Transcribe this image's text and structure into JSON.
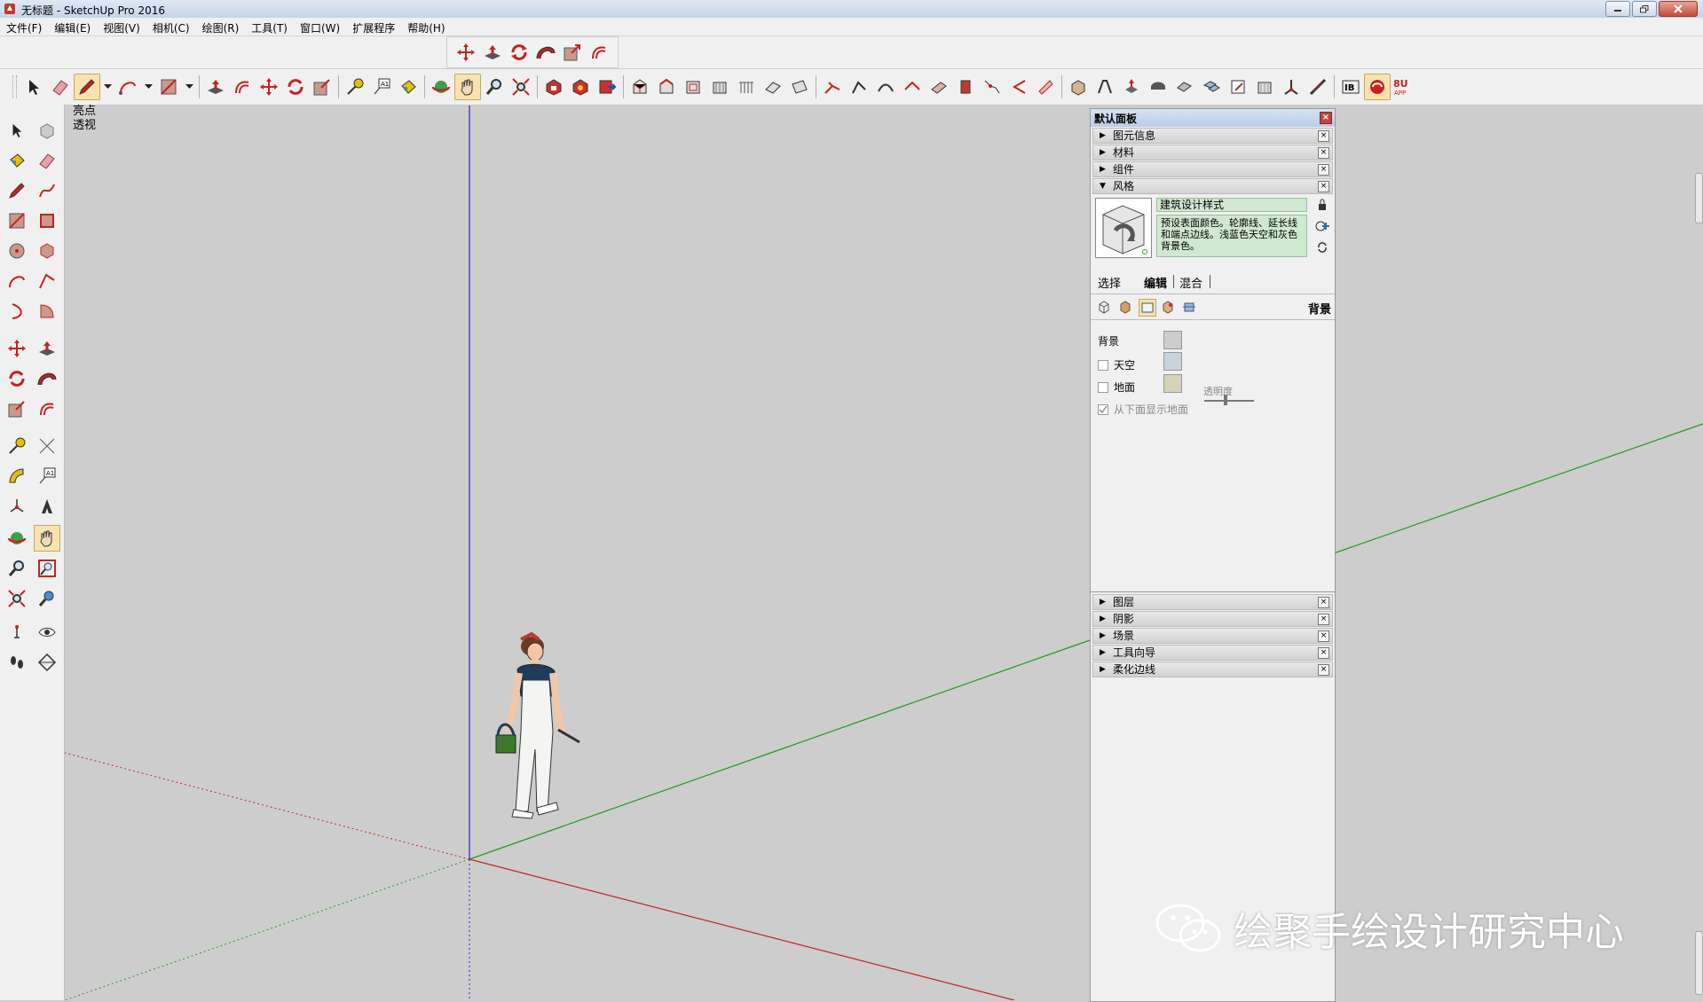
{
  "window": {
    "title": "无标题 - SketchUp Pro 2016"
  },
  "menubar": {
    "items": [
      "文件(F)",
      "编辑(E)",
      "视图(V)",
      "相机(C)",
      "绘图(R)",
      "工具(T)",
      "窗口(W)",
      "扩展程序",
      "帮助(H)"
    ]
  },
  "viewport": {
    "scene_line1": "亮点",
    "scene_line2": "透视"
  },
  "tray": {
    "title": "默认面板",
    "panels_top": [
      {
        "label": "图元信息",
        "expanded": false
      },
      {
        "label": "材料",
        "expanded": false
      },
      {
        "label": "组件",
        "expanded": false
      },
      {
        "label": "风格",
        "expanded": true
      }
    ],
    "style": {
      "name": "建筑设计样式",
      "description": "预设表面颜色。轮廓线、延长线和端点边线。浅蓝色天空和灰色背景色。",
      "tabs": [
        "选择",
        "编辑",
        "混合"
      ],
      "active_tab": "编辑",
      "section_label": "背景",
      "background_label": "背景",
      "sky_label": "天空",
      "ground_label": "地面",
      "transparency_label": "透明度",
      "show_ground_from_below": "从下面显示地面",
      "background_color": "#cdcdcd",
      "sky_color": "#c9d3db",
      "ground_color": "#d7d3b9"
    },
    "panels_bottom": [
      {
        "label": "图层"
      },
      {
        "label": "阴影"
      },
      {
        "label": "场景"
      },
      {
        "label": "工具向导"
      },
      {
        "label": "柔化边线"
      }
    ]
  },
  "watermark": {
    "text": "绘聚手绘设计研究中心"
  },
  "colors": {
    "red_axis": "#cc2020",
    "green_axis": "#1e9e1e",
    "blue_axis": "#2222cc"
  }
}
